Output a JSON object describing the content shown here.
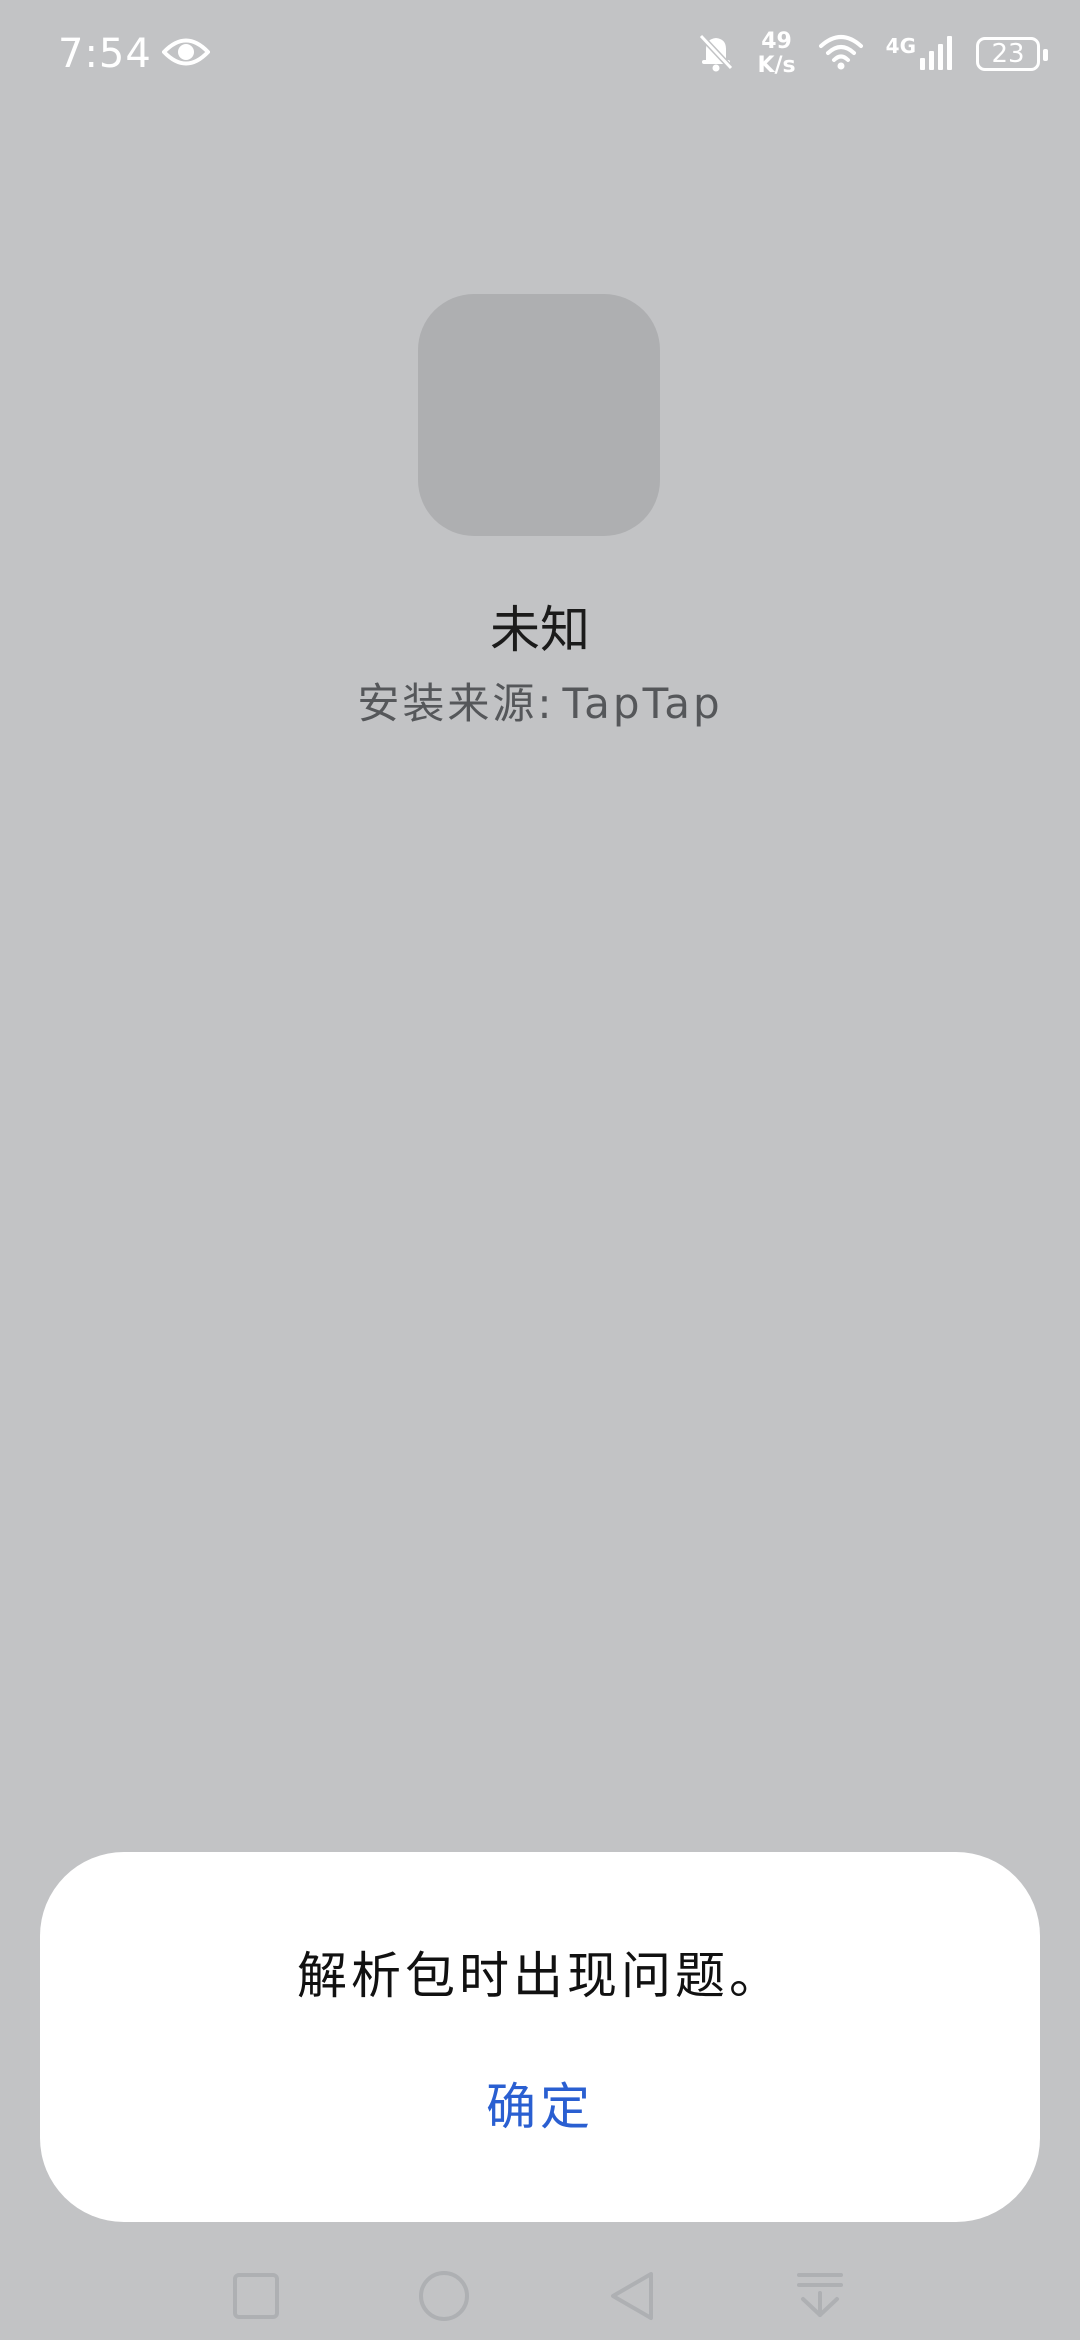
{
  "status_bar": {
    "time": "7:54",
    "net_speed_value": "49",
    "net_speed_unit": "K/s",
    "network_type": "4G",
    "battery_level": "23",
    "icons": [
      "eye-icon",
      "bell-off-icon",
      "wifi-icon",
      "signal-icon",
      "battery-icon"
    ]
  },
  "app": {
    "name": "未知",
    "source_label": "安装来源:",
    "source_value": "TapTap"
  },
  "dialog": {
    "message": "解析包时出现问题。",
    "confirm_label": "确定"
  },
  "nav_bar": {
    "icons": [
      "recents-square-icon",
      "home-circle-icon",
      "back-triangle-icon",
      "pull-down-icon"
    ]
  },
  "colors": {
    "background": "#c2c3c5",
    "icon_placeholder": "#aeafb1",
    "dialog_bg": "#ffffff",
    "accent": "#2a5fd1"
  }
}
